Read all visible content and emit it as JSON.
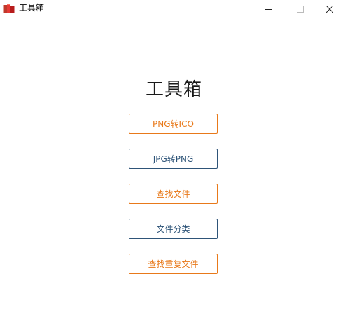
{
  "window": {
    "title": "工具箱",
    "icon": "toolbox-app-icon",
    "controls": {
      "minimize": "minimize-icon",
      "maximize": "maximize-icon",
      "close": "close-icon"
    }
  },
  "main": {
    "title": "工具箱",
    "buttons": [
      {
        "label": "PNG转ICO",
        "color": "#e8791a"
      },
      {
        "label": "JPG转PNG",
        "color": "#2e5478"
      },
      {
        "label": "查找文件",
        "color": "#e8791a"
      },
      {
        "label": "文件分类",
        "color": "#2e5478"
      },
      {
        "label": "查找重复文件",
        "color": "#e8791a"
      }
    ]
  }
}
